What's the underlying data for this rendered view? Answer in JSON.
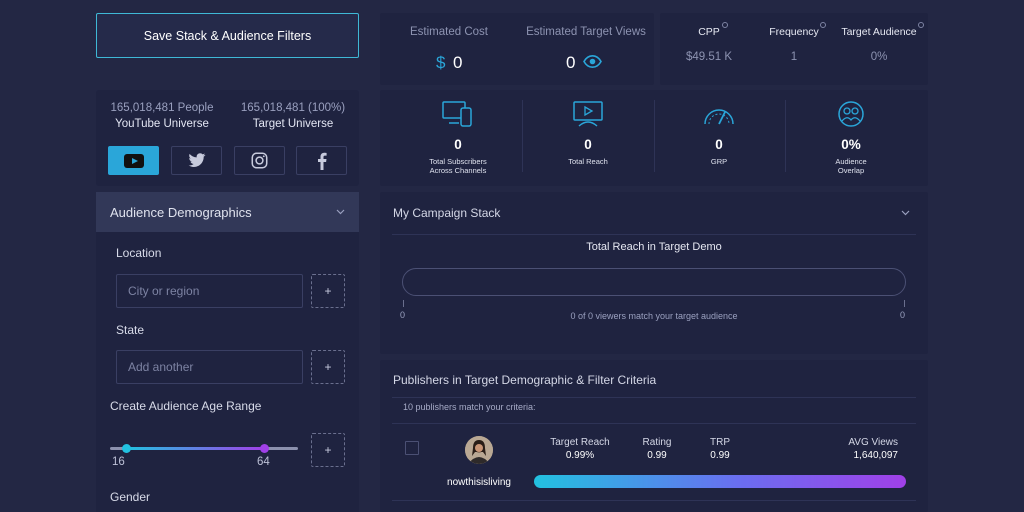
{
  "save_button": "Save Stack & Audience Filters",
  "universe": {
    "youtube_count": "165,018,481 People",
    "youtube_label": "YouTube Universe",
    "target_count": "165,018,481 (100%)",
    "target_label": "Target Universe"
  },
  "social": [
    "youtube-icon",
    "twitter-icon",
    "instagram-icon",
    "facebook-icon"
  ],
  "demographics": {
    "header": "Audience Demographics",
    "location_label": "Location",
    "location_placeholder": "City or region",
    "state_label": "State",
    "state_placeholder": "Add another",
    "plus": "+",
    "age_label": "Create Audience Age Range",
    "age_min": "16",
    "age_max": "64",
    "age_min_fraction": 0.09,
    "age_max_fraction": 0.82,
    "gender_label": "Gender"
  },
  "estimates": {
    "cost_title": "Estimated Cost",
    "cost_symbol": "$",
    "cost_value": "0",
    "views_title": "Estimated Target Views",
    "views_value": "0"
  },
  "metrics": {
    "cpp_title": "CPP",
    "cpp_value": "$49.51 K",
    "freq_title": "Frequency",
    "freq_value": "1",
    "aud_title": "Target Audience",
    "aud_value": "0%"
  },
  "kpis": [
    {
      "icon": "devices-icon",
      "value": "0",
      "label1": "Total Subscribers",
      "label2": "Across Channels"
    },
    {
      "icon": "reach-screen-icon",
      "value": "0",
      "label1": "Total Reach",
      "label2": ""
    },
    {
      "icon": "gauge-icon",
      "value": "0",
      "label1": "GRP",
      "label2": ""
    },
    {
      "icon": "audience-overlap-icon",
      "value": "0%",
      "label1": "Audience",
      "label2": "Overlap"
    }
  ],
  "stack": {
    "title": "My Campaign Stack",
    "reach_title": "Total Reach in Target Demo",
    "min": "0",
    "max": "0",
    "caption": "0 of 0 viewers match your target audience"
  },
  "publishers": {
    "title": "Publishers in Target Demographic & Filter Criteria",
    "count_text": "10 publishers match your criteria:",
    "col_reach": "Target Reach",
    "col_rating": "Rating",
    "col_trp": "TRP",
    "col_views": "AVG Views",
    "row": {
      "name": "nowthisisliving",
      "reach": "0.99%",
      "rating": "0.99",
      "trp": "0.99",
      "views": "1,640,097"
    }
  },
  "colors": {
    "accent": "#2aa6d9",
    "purple": "#a040e8",
    "background": "#232744",
    "panel": "#1f2340"
  }
}
